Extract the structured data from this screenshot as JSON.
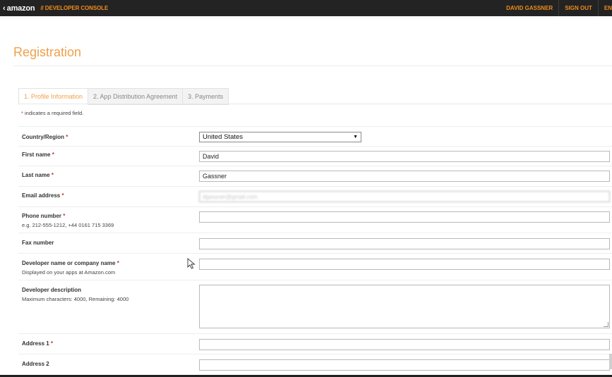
{
  "topbar": {
    "back_glyph": "‹",
    "brand": "amazon",
    "console_title": "// DEVELOPER CONSOLE",
    "user_name": "DAVID GASSNER",
    "sign_out": "SIGN OUT",
    "language": "EN"
  },
  "page": {
    "title": "Registration"
  },
  "tabs": [
    {
      "label": "1. Profile Information",
      "active": true
    },
    {
      "label": "2. App Distribution Agreement",
      "active": false
    },
    {
      "label": "3. Payments",
      "active": false
    }
  ],
  "required_note": {
    "star": "*",
    "text": " indicates a required field."
  },
  "form": {
    "country": {
      "label": "Country/Region",
      "required_mark": "*",
      "value": "United States"
    },
    "first_name": {
      "label": "First name",
      "required_mark": "*",
      "value": "David"
    },
    "last_name": {
      "label": "Last name",
      "required_mark": "*",
      "value": "Gassner"
    },
    "email": {
      "label": "Email address",
      "required_mark": "*",
      "value": "dgassner@gmail.com"
    },
    "phone": {
      "label": "Phone number",
      "required_mark": "*",
      "hint": "e.g. 212-555-1212, +44 0161 715 3369",
      "value": ""
    },
    "fax": {
      "label": "Fax number",
      "value": ""
    },
    "developer_name": {
      "label": "Developer name or company name",
      "required_mark": "*",
      "hint": "Displayed on your apps at Amazon.com",
      "value": ""
    },
    "description": {
      "label": "Developer description",
      "hint": "Maximum characters: 4000, Remaining: 4000",
      "value": ""
    },
    "address1": {
      "label": "Address 1",
      "required_mark": "*",
      "value": ""
    },
    "address2": {
      "label": "Address 2",
      "value": ""
    }
  },
  "colors": {
    "accent": "#f0a04b",
    "topbar_bg": "#232323",
    "topbar_accent": "#f08c1a",
    "required": "#c0392b"
  },
  "icons": {
    "dropdown": "triangle-down-icon",
    "back": "chevron-left-icon",
    "cursor": "mouse-pointer-icon"
  }
}
